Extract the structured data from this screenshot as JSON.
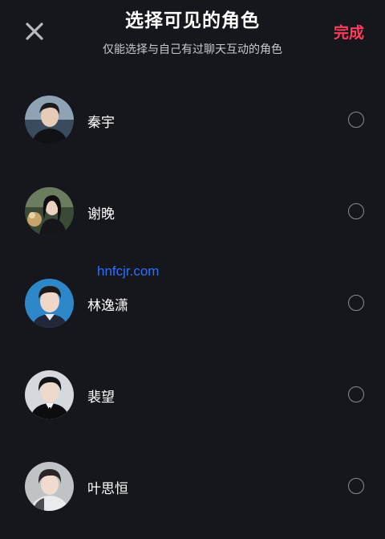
{
  "header": {
    "title": "选择可见的角色",
    "subtitle": "仅能选择与自己有过聊天互动的角色",
    "done_label": "完成"
  },
  "characters": [
    {
      "name": "秦宇",
      "selected": false
    },
    {
      "name": "谢晚",
      "selected": false
    },
    {
      "name": "林逸潇",
      "selected": false
    },
    {
      "name": "裴望",
      "selected": false
    },
    {
      "name": "叶思恒",
      "selected": false
    }
  ],
  "watermark": "hnfcjr.com",
  "colors": {
    "background": "#16161d",
    "accent": "#ff3d5a",
    "radio_border": "#8b8b92",
    "watermark": "#2f6ff7"
  },
  "icons": {
    "close": "close-icon",
    "radio": "radio-unchecked-icon"
  }
}
